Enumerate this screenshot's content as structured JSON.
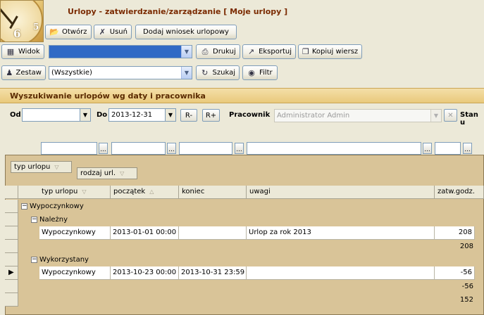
{
  "window": {
    "title": "Urlopy - zatwierdzanie/zarządzanie [ Moje urlopy ]"
  },
  "toolbar": {
    "open_label": "Otwórz",
    "delete_label": "Usuń",
    "add_request_label": "Dodaj wniosek urlopowy",
    "view_label": "Widok",
    "view_value": "",
    "print_label": "Drukuj",
    "export_label": "Eksportuj",
    "copy_row_label": "Kopiuj wiersz",
    "set_label": "Zestaw",
    "set_value": "(Wszystkie)",
    "search_label": "Szukaj",
    "filter_label": "Filtr"
  },
  "search_panel": {
    "heading": "Wyszukiwanie urlopów wg daty i pracownika",
    "from_label": "Od",
    "from_value": "",
    "to_label": "Do",
    "to_value": "2013-12-31",
    "r_minus": "R-",
    "r_plus": "R+",
    "employee_label": "Pracownik",
    "employee_value": "Administrator Admin",
    "status_label": "Stan u"
  },
  "grouping": {
    "group1": "typ urlopu",
    "group2": "rodzaj url."
  },
  "grid": {
    "columns": [
      "typ urlopu",
      "początek",
      "koniec",
      "uwagi",
      "zatw.godz."
    ],
    "groups": [
      {
        "label": "Wypoczynkowy"
      },
      {
        "label": "Należny"
      },
      {
        "label": "Wykorzystany"
      }
    ],
    "rows": [
      {
        "typ": "Wypoczynkowy",
        "poczatek": "2013-01-01 00:00",
        "koniec": "",
        "uwagi": "Urlop za rok 2013",
        "godz": "208"
      },
      {
        "typ": "Wypoczynkowy",
        "poczatek": "2013-10-23 00:00",
        "koniec": "2013-10-31 23:59",
        "uwagi": "",
        "godz": "-56"
      }
    ],
    "subtotals": {
      "nalezny": "208",
      "wykorzystany": "-56",
      "total": "152"
    }
  }
}
